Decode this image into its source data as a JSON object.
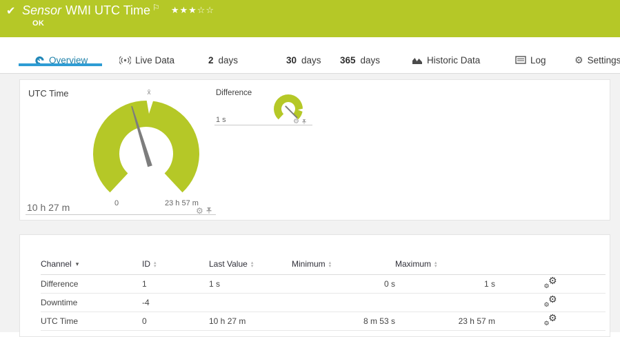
{
  "colors": {
    "brand-green": "#b5c827",
    "tab-blue": "#2e9cd4",
    "tab-blue-text": "#1b7fa8"
  },
  "header": {
    "check_icon": "✔",
    "kind": "Sensor",
    "title": "WMI UTC Time",
    "flag_icon": "⚐",
    "stars_filled": "★★★",
    "stars_empty": "☆☆",
    "status": "OK"
  },
  "tabs": [
    {
      "label": "Overview",
      "active": true
    },
    {
      "label": "Live Data"
    },
    {
      "num": "2",
      "label": "days"
    },
    {
      "num": "30",
      "label": "days"
    },
    {
      "num": "365",
      "label": "days"
    },
    {
      "label": "Historic Data"
    },
    {
      "label": "Log"
    },
    {
      "label": "Settings"
    }
  ],
  "gauges": {
    "primary": {
      "title": "UTC Time",
      "value": "10 h 27 m",
      "scale_min": "0",
      "scale_max": "23 h 57 m",
      "mean_marker": "x̄"
    },
    "secondary": {
      "title": "Difference",
      "value": "1 s"
    }
  },
  "channel_table": {
    "headers": {
      "channel": "Channel",
      "id": "ID",
      "last_value": "Last Value",
      "minimum": "Minimum",
      "maximum": "Maximum"
    },
    "rows": [
      {
        "channel": "Difference",
        "id": "1",
        "last_value": "1 s",
        "minimum": "0 s",
        "maximum": "1 s"
      },
      {
        "channel": "Downtime",
        "id": "-4",
        "last_value": "",
        "minimum": "",
        "maximum": ""
      },
      {
        "channel": "UTC Time",
        "id": "0",
        "last_value": "10 h 27 m",
        "minimum": "8 m 53 s",
        "maximum": "23 h 57 m"
      }
    ]
  },
  "icons": {
    "gear": "⚙",
    "sort_up": "▴",
    "sort_down": "▾"
  }
}
